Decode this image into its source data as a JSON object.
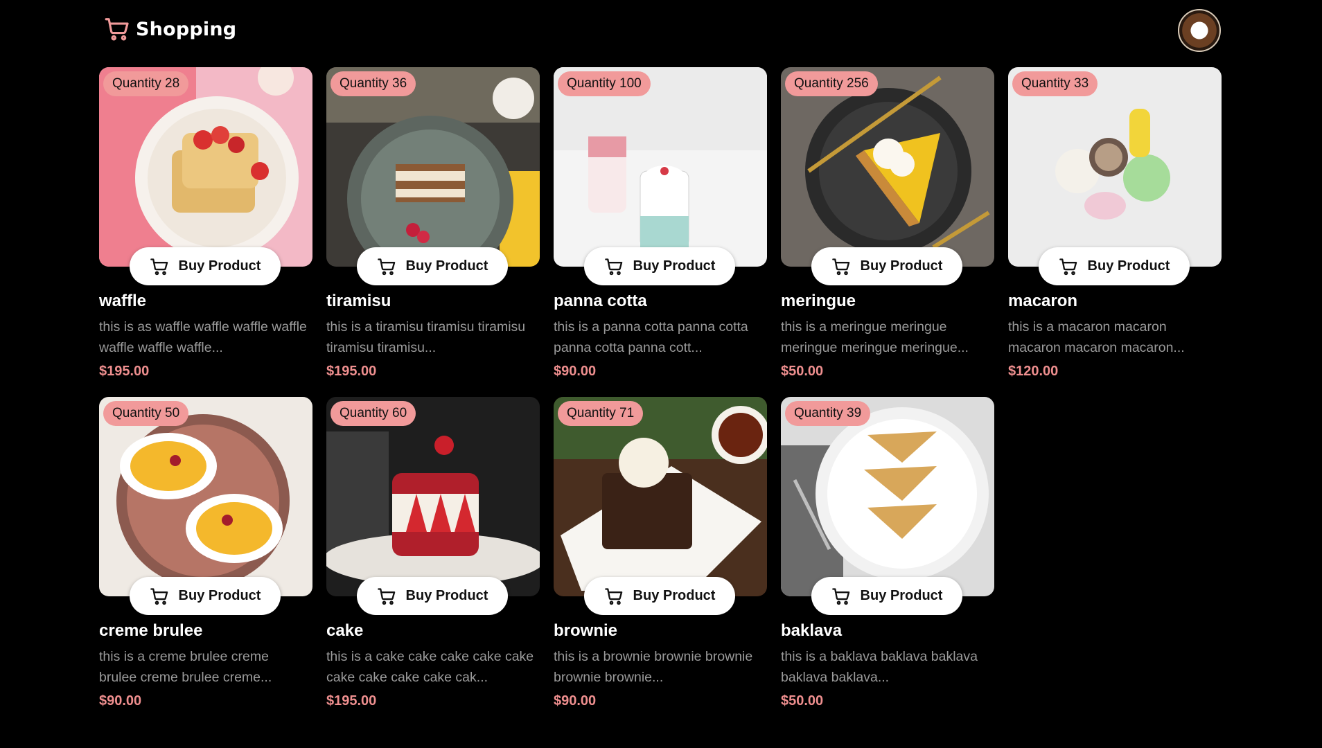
{
  "header": {
    "title": "Shopping",
    "logo_icon": "shopping-cart-icon",
    "avatar": "user-avatar"
  },
  "colors": {
    "background": "#000000",
    "accent": "#f19a9a",
    "price": "#ef8f8f",
    "muted_text": "#9a9a9a"
  },
  "products": [
    {
      "qty_label": "Quantity 28",
      "name": "waffle",
      "description": "this is as waffle waffle waffle waffle waffle waffle waffle...",
      "price": "$195.00",
      "button_label": "Buy Product",
      "image": "waffle-photo"
    },
    {
      "qty_label": "Quantity 36",
      "name": "tiramisu",
      "description": "this is a tiramisu tiramisu tiramisu tiramisu tiramisu...",
      "price": "$195.00",
      "button_label": "Buy Product",
      "image": "tiramisu-photo"
    },
    {
      "qty_label": "Quantity 100",
      "name": "panna cotta",
      "description": "this is a panna cotta panna cotta panna cotta panna cott...",
      "price": "$90.00",
      "button_label": "Buy Product",
      "image": "panna-cotta-photo"
    },
    {
      "qty_label": "Quantity 256",
      "name": "meringue",
      "description": "this is a meringue meringue meringue meringue meringue...",
      "price": "$50.00",
      "button_label": "Buy Product",
      "image": "meringue-photo"
    },
    {
      "qty_label": "Quantity 33",
      "name": "macaron",
      "description": "this is a macaron macaron macaron macaron macaron...",
      "price": "$120.00",
      "button_label": "Buy Product",
      "image": "macaron-photo"
    },
    {
      "qty_label": "Quantity 50",
      "name": "creme brulee",
      "description": "this is a creme brulee creme brulee creme brulee creme...",
      "price": "$90.00",
      "button_label": "Buy Product",
      "image": "creme-brulee-photo"
    },
    {
      "qty_label": "Quantity 60",
      "name": "cake",
      "description": "this is a cake cake cake cake cake cake cake cake cake cak...",
      "price": "$195.00",
      "button_label": "Buy Product",
      "image": "cake-photo"
    },
    {
      "qty_label": "Quantity 71",
      "name": "brownie",
      "description": "this is a brownie brownie brownie brownie brownie...",
      "price": "$90.00",
      "button_label": "Buy Product",
      "image": "brownie-photo"
    },
    {
      "qty_label": "Quantity 39",
      "name": "baklava",
      "description": "this is a baklava baklava baklava baklava baklava...",
      "price": "$50.00",
      "button_label": "Buy Product",
      "image": "baklava-photo"
    }
  ]
}
